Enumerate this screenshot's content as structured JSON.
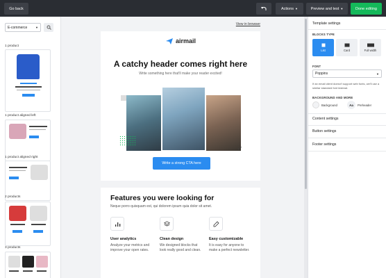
{
  "topbar": {
    "back_label": "Go back",
    "actions_label": "Actions",
    "preview_label": "Preview and test",
    "done_label": "Done editing"
  },
  "sidebar": {
    "category": "E-commerce",
    "groups": [
      {
        "label": "1 product"
      },
      {
        "label": "1 product aligned left"
      },
      {
        "label": "1 product aligned right"
      },
      {
        "label": "2 products"
      },
      {
        "label": "3 products"
      }
    ]
  },
  "email": {
    "view_in_browser": "View in browser",
    "logo_text": "airmail",
    "headline": "A catchy header comes right here",
    "subheadline": "Write something here that'll make your reader excited!",
    "cta_label": "Write a strong CTA here",
    "features_title": "Features you were looking for",
    "features_sub": "Neque porro quisquam est, qui dolorem ipsum quia dolor sit amet.",
    "features": [
      {
        "title": "User analytics",
        "desc": "Analyze your metrics and improve your open rates.",
        "icon": "bar-chart-icon"
      },
      {
        "title": "Clean design",
        "desc": "We designed blocks that look really good and clean.",
        "icon": "layers-icon"
      },
      {
        "title": "Easy customizable",
        "desc": "It is easy for anyone to make a perfect newsletter.",
        "icon": "edit-icon"
      }
    ]
  },
  "panel": {
    "template_settings": "Template settings",
    "blocks_type_label": "BLOCKS TYPE",
    "layouts": [
      "List",
      "Card",
      "Full width"
    ],
    "font_label": "FONT",
    "font_value": "Poppins",
    "font_note": "If an email client doesn't support web fonts, we'll use a similar standard font instead.",
    "bg_label": "BACKGROUND AND MORE",
    "bg_item": "Background",
    "preheader_sample": "Aa",
    "preheader_item": "Preheader",
    "content_settings": "Content settings",
    "button_settings": "Button settings",
    "footer_settings": "Footer settings"
  },
  "colors": {
    "accent": "#2b8cf0",
    "green": "#14b85a",
    "topbar": "#2a2d33"
  }
}
